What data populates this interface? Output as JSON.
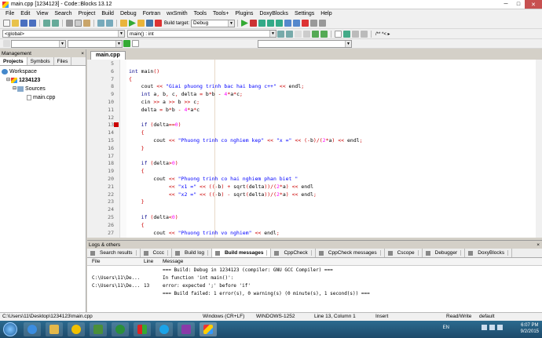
{
  "window": {
    "title": "main.cpp [1234123] - Code::Blocks 13.12",
    "min": "─",
    "max": "□",
    "close": "✕"
  },
  "menu": [
    "File",
    "Edit",
    "View",
    "Search",
    "Project",
    "Build",
    "Debug",
    "Fortran",
    "wxSmith",
    "Tools",
    "Tools+",
    "Plugins",
    "DoxyBlocks",
    "Settings",
    "Help"
  ],
  "toolbar": {
    "build_target": "Debug",
    "scope": "<global>",
    "function": "main() : int",
    "regex_buttons": "/** *< ▸"
  },
  "management": {
    "header": "Management",
    "close": "×",
    "tabs": [
      "Projects",
      "Symbols",
      "Files"
    ],
    "tree": {
      "workspace": "Workspace",
      "project": "1234123",
      "folder": "Sources",
      "file": "main.cpp"
    }
  },
  "editor": {
    "tab": "main.cpp",
    "lines": [
      {
        "n": "5",
        "t": ""
      },
      {
        "n": "6",
        "t": "int main()"
      },
      {
        "n": "7",
        "t": "{"
      },
      {
        "n": "8",
        "t": "    cout << \"Giai phuong trinh bac hai bang c++\" << endl;"
      },
      {
        "n": "9",
        "t": "    int a, b, c, delta = b*b - 4*a*c;"
      },
      {
        "n": "10",
        "t": "    cin >> a >> b >> c;"
      },
      {
        "n": "11",
        "t": "    delta = b*b - 4*a*c"
      },
      {
        "n": "12",
        "t": ""
      },
      {
        "n": "13",
        "t": "    if (delta==0)"
      },
      {
        "n": "14",
        "t": "    {"
      },
      {
        "n": "15",
        "t": "        cout << \"Phuong trinh co nghiem kep\" << \"x =\" << (-b)/(2*a) << endl;"
      },
      {
        "n": "16",
        "t": "    }"
      },
      {
        "n": "17",
        "t": ""
      },
      {
        "n": "18",
        "t": "    if (delta>0)"
      },
      {
        "n": "19",
        "t": "    {"
      },
      {
        "n": "20",
        "t": "        cout << \"Phuong trinh co hai nghiem phan biet \""
      },
      {
        "n": "21",
        "t": "             << \"x1 =\" << ((-b) + sqrt(delta))/(2*a) << endl"
      },
      {
        "n": "22",
        "t": "             << \"x2 =\" << ((-b) - sqrt(delta))/(2*a) << endl;"
      },
      {
        "n": "23",
        "t": "    }"
      },
      {
        "n": "24",
        "t": ""
      },
      {
        "n": "25",
        "t": "    if (delta<0)"
      },
      {
        "n": "26",
        "t": "    {"
      },
      {
        "n": "27",
        "t": "        cout << \"Phuong trinh vo nghiem\" << endl;"
      }
    ]
  },
  "logs": {
    "header": "Logs & others",
    "close": "×",
    "tabs": [
      "Search results",
      "Cccc",
      "Build log",
      "Build messages",
      "CppCheck",
      "CppCheck messages",
      "Cscope",
      "Debugger",
      "DoxyBlocks"
    ],
    "columns": [
      "File",
      "Line",
      "Message"
    ],
    "rows": [
      {
        "file": "",
        "line": "",
        "msg": "=== Build: Debug in 1234123 (compiler: GNU GCC Compiler) ==="
      },
      {
        "file": "C:\\Users\\11\\De...",
        "line": "",
        "msg": "In function 'int main()':"
      },
      {
        "file": "C:\\Users\\11\\De...",
        "line": "13",
        "msg": "error: expected ';' before 'if'"
      },
      {
        "file": "",
        "line": "",
        "msg": "=== Build failed: 1 error(s), 0 warning(s) (0 minute(s), 1 second(s)) ==="
      }
    ]
  },
  "status": {
    "path": "C:\\Users\\11\\Desktop\\1234123\\main.cpp",
    "eol": "Windows (CR+LF)",
    "encoding": "WINDOWS-1252",
    "position": "Line 13, Column 1",
    "mode": "Insert",
    "rw": "Read/Write",
    "profile": "default"
  },
  "taskbar": {
    "lang": "EN",
    "time": "6:07 PM",
    "date": "9/2/2015"
  },
  "colors": {
    "keyword": "#00008b",
    "string": "#0000ff",
    "operator": "#cc0000",
    "number": "#ff00ff",
    "error_marker": "#cc0000"
  }
}
